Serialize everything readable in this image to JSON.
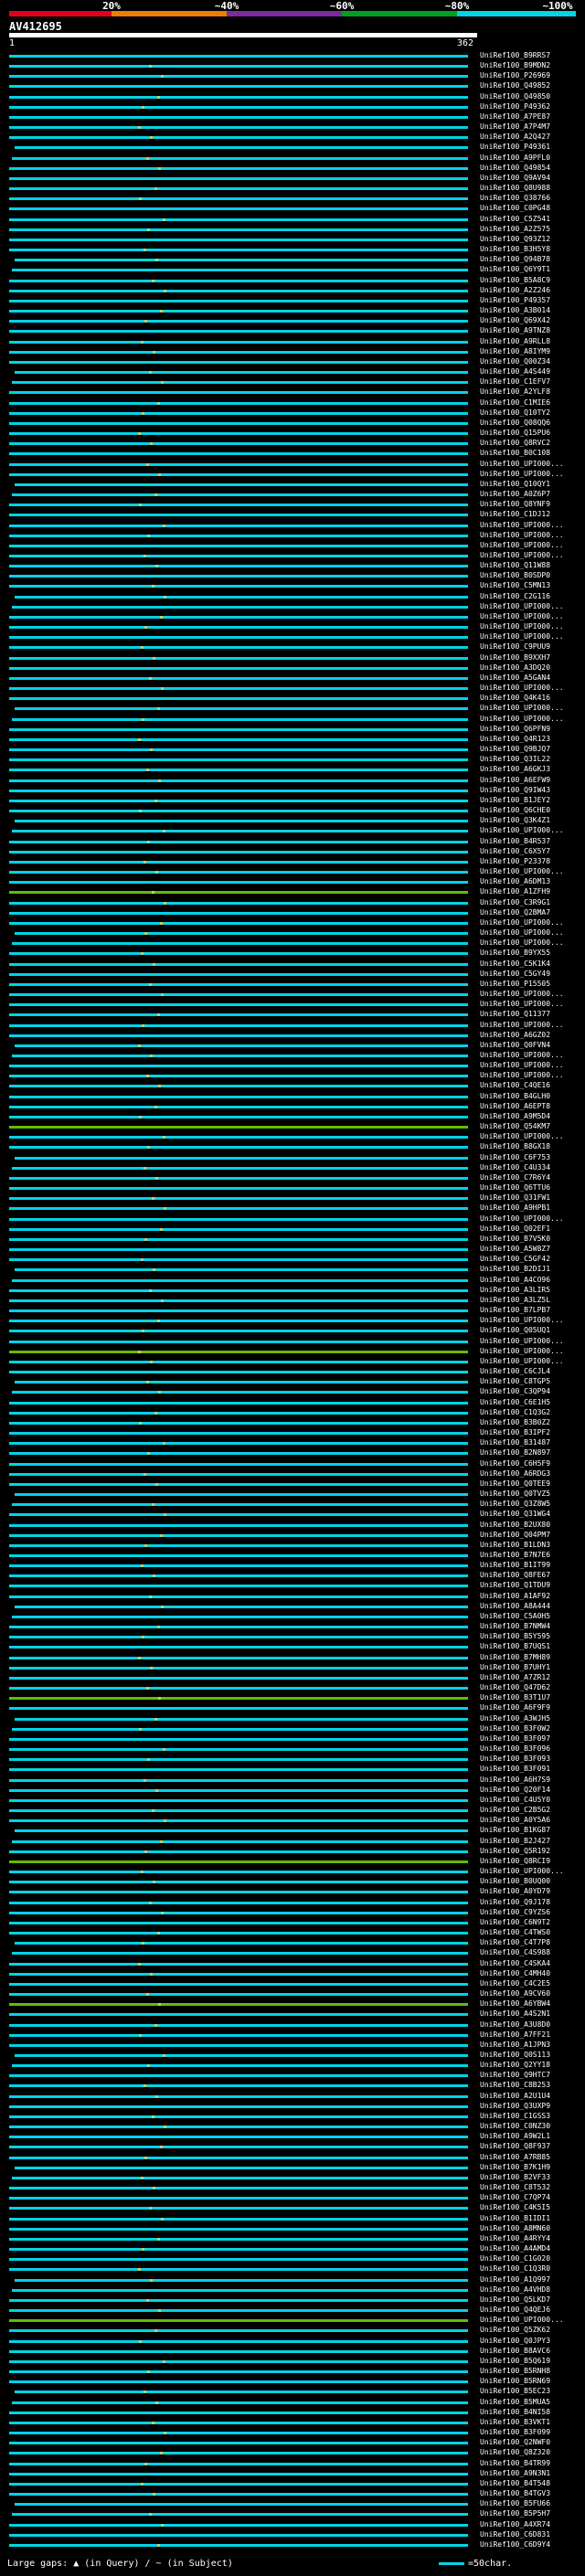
{
  "scale": {
    "ticks": [
      "20%",
      "~40%",
      "~60%",
      "~80%",
      "~100%"
    ],
    "band_colors": [
      "#e0001a",
      "#f07c00",
      "#7d2a9e",
      "#00a020",
      "#00d4e6"
    ]
  },
  "query": {
    "id": "AV412695",
    "start_label": "1",
    "end_label": "362"
  },
  "colors": {
    "high_identity": "#00d4e6",
    "mid_identity": "#66bb00",
    "dot": "#cccc66"
  },
  "hits": [
    {
      "label": "UniRef100_B9RRS7",
      "color": "#00d4e6"
    },
    {
      "label": "UniRef100_B9MDN2",
      "color": "#00d4e6"
    },
    {
      "label": "UniRef100_P26969",
      "color": "#00d4e6"
    },
    {
      "label": "UniRef100_Q49852",
      "color": "#00d4e6"
    },
    {
      "label": "UniRef100_Q49850",
      "color": "#00d4e6"
    },
    {
      "label": "UniRef100_P49362",
      "color": "#00d4e6"
    },
    {
      "label": "UniRef100_A7PE87",
      "color": "#00d4e6"
    },
    {
      "label": "UniRef100_A7P4M7",
      "color": "#00d4e6"
    },
    {
      "label": "UniRef100_A2Q427",
      "color": "#00d4e6"
    },
    {
      "label": "UniRef100_P49361",
      "color": "#00d4e6"
    },
    {
      "label": "UniRef100_A9PFL0",
      "color": "#00d4e6"
    },
    {
      "label": "UniRef100_Q49854",
      "color": "#00d4e6"
    },
    {
      "label": "UniRef100_Q9AV94",
      "color": "#00d4e6"
    },
    {
      "label": "UniRef100_Q8U988",
      "color": "#00d4e6"
    },
    {
      "label": "UniRef100_Q38766",
      "color": "#00d4e6"
    },
    {
      "label": "UniRef100_C0PG48",
      "color": "#00d4e6"
    },
    {
      "label": "UniRef100_C5Z541",
      "color": "#00d4e6"
    },
    {
      "label": "UniRef100_A2Z575",
      "color": "#00d4e6"
    },
    {
      "label": "UniRef100_Q93Z12",
      "color": "#00d4e6"
    },
    {
      "label": "UniRef100_B3H5Y8",
      "color": "#00d4e6"
    },
    {
      "label": "UniRef100_Q94B78",
      "color": "#00d4e6"
    },
    {
      "label": "UniRef100_Q6Y9T1",
      "color": "#00d4e6"
    },
    {
      "label": "UniRef100_B5A8C9",
      "color": "#00d4e6"
    },
    {
      "label": "UniRef100_A2Z246",
      "color": "#00d4e6"
    },
    {
      "label": "UniRef100_P49357",
      "color": "#00d4e6"
    },
    {
      "label": "UniRef100_A3B014",
      "color": "#00d4e6"
    },
    {
      "label": "UniRef100_Q69X42",
      "color": "#00d4e6"
    },
    {
      "label": "UniRef100_A9TNZ8",
      "color": "#00d4e6"
    },
    {
      "label": "UniRef100_A9RLL8",
      "color": "#00d4e6"
    },
    {
      "label": "UniRef100_A8IYM9",
      "color": "#00d4e6"
    },
    {
      "label": "UniRef100_Q00Z34",
      "color": "#00d4e6"
    },
    {
      "label": "UniRef100_A4S449",
      "color": "#00d4e6"
    },
    {
      "label": "UniRef100_C1EFV7",
      "color": "#00d4e6"
    },
    {
      "label": "UniRef100_A2YLF8",
      "color": "#00d4e6"
    },
    {
      "label": "UniRef100_C1MIE6",
      "color": "#00d4e6"
    },
    {
      "label": "UniRef100_Q10TY2",
      "color": "#00d4e6"
    },
    {
      "label": "UniRef100_Q08QQ6",
      "color": "#00d4e6"
    },
    {
      "label": "UniRef100_Q15PU6",
      "color": "#00d4e6"
    },
    {
      "label": "UniRef100_Q8RVC2",
      "color": "#00d4e6"
    },
    {
      "label": "UniRef100_B0C108",
      "color": "#00d4e6"
    },
    {
      "label": "UniRef100_UPI000...",
      "color": "#00d4e6"
    },
    {
      "label": "UniRef100_UPI000...",
      "color": "#00d4e6"
    },
    {
      "label": "UniRef100_Q10QY1",
      "color": "#00d4e6"
    },
    {
      "label": "UniRef100_A0Z6P7",
      "color": "#00d4e6"
    },
    {
      "label": "UniRef100_Q8YNF9",
      "color": "#00d4e6"
    },
    {
      "label": "UniRef100_C1DJ12",
      "color": "#00d4e6"
    },
    {
      "label": "UniRef100_UPI000...",
      "color": "#00d4e6"
    },
    {
      "label": "UniRef100_UPI000...",
      "color": "#00d4e6"
    },
    {
      "label": "UniRef100_UPI000...",
      "color": "#00d4e6"
    },
    {
      "label": "UniRef100_UPI000...",
      "color": "#00d4e6"
    },
    {
      "label": "UniRef100_Q11W88",
      "color": "#00d4e6"
    },
    {
      "label": "UniRef100_B0SDP0",
      "color": "#00d4e6"
    },
    {
      "label": "UniRef100_C5MN13",
      "color": "#00d4e6"
    },
    {
      "label": "UniRef100_C2G116",
      "color": "#00d4e6"
    },
    {
      "label": "UniRef100_UPI000...",
      "color": "#00d4e6"
    },
    {
      "label": "UniRef100_UPI000...",
      "color": "#00d4e6"
    },
    {
      "label": "UniRef100_UPI000...",
      "color": "#00d4e6"
    },
    {
      "label": "UniRef100_UPI000...",
      "color": "#00d4e6"
    },
    {
      "label": "UniRef100_C9PUU9",
      "color": "#00d4e6"
    },
    {
      "label": "UniRef100_B9XXH7",
      "color": "#00d4e6"
    },
    {
      "label": "UniRef100_A3DQ20",
      "color": "#00d4e6"
    },
    {
      "label": "UniRef100_A5GAN4",
      "color": "#00d4e6"
    },
    {
      "label": "UniRef100_UPI000...",
      "color": "#00d4e6"
    },
    {
      "label": "UniRef100_Q4K416",
      "color": "#00d4e6"
    },
    {
      "label": "UniRef100_UPI000...",
      "color": "#00d4e6"
    },
    {
      "label": "UniRef100_UPI000...",
      "color": "#00d4e6"
    },
    {
      "label": "UniRef100_Q6PFN9",
      "color": "#00d4e6"
    },
    {
      "label": "UniRef100_Q4R123",
      "color": "#00d4e6"
    },
    {
      "label": "UniRef100_Q9BJQ7",
      "color": "#00d4e6"
    },
    {
      "label": "UniRef100_Q3IL22",
      "color": "#00d4e6"
    },
    {
      "label": "UniRef100_A6GKJ3",
      "color": "#00d4e6"
    },
    {
      "label": "UniRef100_A6EFW9",
      "color": "#00d4e6"
    },
    {
      "label": "UniRef100_Q9IW43",
      "color": "#00d4e6"
    },
    {
      "label": "UniRef100_B1JEY2",
      "color": "#00d4e6"
    },
    {
      "label": "UniRef100_Q6CHE0",
      "color": "#00d4e6"
    },
    {
      "label": "UniRef100_Q3K4Z1",
      "color": "#00d4e6"
    },
    {
      "label": "UniRef100_UPI000...",
      "color": "#00d4e6"
    },
    {
      "label": "UniRef100_B4R537",
      "color": "#00d4e6"
    },
    {
      "label": "UniRef100_C6X5Y7",
      "color": "#00d4e6"
    },
    {
      "label": "UniRef100_P23378",
      "color": "#00d4e6"
    },
    {
      "label": "UniRef100_UPI000...",
      "color": "#00d4e6"
    },
    {
      "label": "UniRef100_A6DM13",
      "color": "#00d4e6"
    },
    {
      "label": "UniRef100_A1ZFH9",
      "color": "#66bb00"
    },
    {
      "label": "UniRef100_C3R9G1",
      "color": "#00d4e6"
    },
    {
      "label": "UniRef100_Q2BMA7",
      "color": "#00d4e6"
    },
    {
      "label": "UniRef100_UPI000...",
      "color": "#00d4e6"
    },
    {
      "label": "UniRef100_UPI000...",
      "color": "#00d4e6"
    },
    {
      "label": "UniRef100_UPI000...",
      "color": "#00d4e6"
    },
    {
      "label": "UniRef100_B9YX55",
      "color": "#00d4e6"
    },
    {
      "label": "UniRef100_C5K1K4",
      "color": "#00d4e6"
    },
    {
      "label": "UniRef100_C5GY49",
      "color": "#00d4e6"
    },
    {
      "label": "UniRef100_P15505",
      "color": "#00d4e6"
    },
    {
      "label": "UniRef100_UPI000...",
      "color": "#00d4e6"
    },
    {
      "label": "UniRef100_UPI000...",
      "color": "#00d4e6"
    },
    {
      "label": "UniRef100_Q11377",
      "color": "#00d4e6"
    },
    {
      "label": "UniRef100_UPI000...",
      "color": "#00d4e6"
    },
    {
      "label": "UniRef100_A6GZ02",
      "color": "#00d4e6"
    },
    {
      "label": "UniRef100_Q0FVN4",
      "color": "#00d4e6"
    },
    {
      "label": "UniRef100_UPI000...",
      "color": "#00d4e6"
    },
    {
      "label": "UniRef100_UPI000...",
      "color": "#00d4e6"
    },
    {
      "label": "UniRef100_UPI000...",
      "color": "#00d4e6"
    },
    {
      "label": "UniRef100_C4QE16",
      "color": "#00d4e6"
    },
    {
      "label": "UniRef100_B4GLH0",
      "color": "#00d4e6"
    },
    {
      "label": "UniRef100_A6EPT8",
      "color": "#00d4e6"
    },
    {
      "label": "UniRef100_A9M5D4",
      "color": "#00d4e6"
    },
    {
      "label": "UniRef100_Q54KM7",
      "color": "#66bb00"
    },
    {
      "label": "UniRef100_UPI000...",
      "color": "#00d4e6"
    },
    {
      "label": "UniRef100_B8GX18",
      "color": "#00d4e6"
    },
    {
      "label": "UniRef100_C6F753",
      "color": "#00d4e6"
    },
    {
      "label": "UniRef100_C4U334",
      "color": "#00d4e6"
    },
    {
      "label": "UniRef100_C7R6Y4",
      "color": "#00d4e6"
    },
    {
      "label": "UniRef100_Q6TTU6",
      "color": "#00d4e6"
    },
    {
      "label": "UniRef100_Q31FW1",
      "color": "#00d4e6"
    },
    {
      "label": "UniRef100_A9HPB1",
      "color": "#00d4e6"
    },
    {
      "label": "UniRef100_UPI000...",
      "color": "#00d4e6"
    },
    {
      "label": "UniRef100_Q02EF1",
      "color": "#00d4e6"
    },
    {
      "label": "UniRef100_B7V5K0",
      "color": "#00d4e6"
    },
    {
      "label": "UniRef100_A5W8Z7",
      "color": "#00d4e6"
    },
    {
      "label": "UniRef100_C5GF42",
      "color": "#00d4e6"
    },
    {
      "label": "UniRef100_B2DIJ1",
      "color": "#00d4e6"
    },
    {
      "label": "UniRef100_A4CO96",
      "color": "#00d4e6"
    },
    {
      "label": "UniRef100_A3LIR5",
      "color": "#00d4e6"
    },
    {
      "label": "UniRef100_A3LZ5L",
      "color": "#00d4e6"
    },
    {
      "label": "UniRef100_B7LPB7",
      "color": "#00d4e6"
    },
    {
      "label": "UniRef100_UPI000...",
      "color": "#00d4e6"
    },
    {
      "label": "UniRef100_Q05UQ1",
      "color": "#00d4e6"
    },
    {
      "label": "UniRef100_UPI000...",
      "color": "#00d4e6"
    },
    {
      "label": "UniRef100_UPI000...",
      "color": "#66bb00"
    },
    {
      "label": "UniRef100_UPI000...",
      "color": "#00d4e6"
    },
    {
      "label": "UniRef100_C6CJL4",
      "color": "#00d4e6"
    },
    {
      "label": "UniRef100_C8TGP5",
      "color": "#00d4e6"
    },
    {
      "label": "UniRef100_C3QP94",
      "color": "#00d4e6"
    },
    {
      "label": "UniRef100_C6E1H5",
      "color": "#00d4e6"
    },
    {
      "label": "UniRef100_C1Q3G2",
      "color": "#00d4e6"
    },
    {
      "label": "UniRef100_B3B0Z2",
      "color": "#00d4e6"
    },
    {
      "label": "UniRef100_B3IPF2",
      "color": "#00d4e6"
    },
    {
      "label": "UniRef100_B31487",
      "color": "#00d4e6"
    },
    {
      "label": "UniRef100_B2N897",
      "color": "#00d4e6"
    },
    {
      "label": "UniRef100_C6H5F9",
      "color": "#00d4e6"
    },
    {
      "label": "UniRef100_A6RDG3",
      "color": "#00d4e6"
    },
    {
      "label": "UniRef100_Q0TEE9",
      "color": "#00d4e6"
    },
    {
      "label": "UniRef100_Q0TVZ5",
      "color": "#00d4e6"
    },
    {
      "label": "UniRef100_Q3Z8W5",
      "color": "#00d4e6"
    },
    {
      "label": "UniRef100_Q31WG4",
      "color": "#00d4e6"
    },
    {
      "label": "UniRef100_B2UX80",
      "color": "#00d4e6"
    },
    {
      "label": "UniRef100_Q04PM7",
      "color": "#00d4e6"
    },
    {
      "label": "UniRef100_B1LDN3",
      "color": "#00d4e6"
    },
    {
      "label": "UniRef100_B7N7E6",
      "color": "#00d4e6"
    },
    {
      "label": "UniRef100_B1IT99",
      "color": "#00d4e6"
    },
    {
      "label": "UniRef100_Q8FE67",
      "color": "#00d4e6"
    },
    {
      "label": "UniRef100_Q1TDU9",
      "color": "#00d4e6"
    },
    {
      "label": "UniRef100_A1AF92",
      "color": "#00d4e6"
    },
    {
      "label": "UniRef100_A8A444",
      "color": "#00d4e6"
    },
    {
      "label": "UniRef100_C5A0H5",
      "color": "#00d4e6"
    },
    {
      "label": "UniRef100_B7NMW4",
      "color": "#00d4e6"
    },
    {
      "label": "UniRef100_B5Y595",
      "color": "#00d4e6"
    },
    {
      "label": "UniRef100_B7UQS1",
      "color": "#00d4e6"
    },
    {
      "label": "UniRef100_B7MH89",
      "color": "#00d4e6"
    },
    {
      "label": "UniRef100_B7UHY1",
      "color": "#00d4e6"
    },
    {
      "label": "UniRef100_A7ZR12",
      "color": "#00d4e6"
    },
    {
      "label": "UniRef100_Q47D62",
      "color": "#00d4e6"
    },
    {
      "label": "UniRef100_B3T1U7",
      "color": "#66bb00"
    },
    {
      "label": "UniRef100_A6F9F9",
      "color": "#00d4e6"
    },
    {
      "label": "UniRef100_A3WJH5",
      "color": "#00d4e6"
    },
    {
      "label": "UniRef100_B3F0W2",
      "color": "#00d4e6"
    },
    {
      "label": "UniRef100_B3F097",
      "color": "#00d4e6"
    },
    {
      "label": "UniRef100_B3F096",
      "color": "#00d4e6"
    },
    {
      "label": "UniRef100_B3F093",
      "color": "#00d4e6"
    },
    {
      "label": "UniRef100_B3F091",
      "color": "#00d4e6"
    },
    {
      "label": "UniRef100_A6H7S9",
      "color": "#00d4e6"
    },
    {
      "label": "UniRef100_Q20F14",
      "color": "#00d4e6"
    },
    {
      "label": "UniRef100_C4U5Y0",
      "color": "#00d4e6"
    },
    {
      "label": "UniRef100_C2B5G2",
      "color": "#00d4e6"
    },
    {
      "label": "UniRef100_A0Y5A6",
      "color": "#00d4e6"
    },
    {
      "label": "UniRef100_B1KG87",
      "color": "#00d4e6"
    },
    {
      "label": "UniRef100_B2J427",
      "color": "#00d4e6"
    },
    {
      "label": "UniRef100_Q5R192",
      "color": "#00d4e6"
    },
    {
      "label": "UniRef100_Q8RCI9",
      "color": "#66bb00"
    },
    {
      "label": "UniRef100_UPI000...",
      "color": "#00d4e6"
    },
    {
      "label": "UniRef100_B0UQ00",
      "color": "#00d4e6"
    },
    {
      "label": "UniRef100_A0YD79",
      "color": "#00d4e6"
    },
    {
      "label": "UniRef100_Q9J178",
      "color": "#00d4e6"
    },
    {
      "label": "UniRef100_C9YZS6",
      "color": "#00d4e6"
    },
    {
      "label": "UniRef100_C6N9T2",
      "color": "#00d4e6"
    },
    {
      "label": "UniRef100_C4TWS0",
      "color": "#00d4e6"
    },
    {
      "label": "UniRef100_C4T7P8",
      "color": "#00d4e6"
    },
    {
      "label": "UniRef100_C4S988",
      "color": "#00d4e6"
    },
    {
      "label": "UniRef100_C4SKA4",
      "color": "#00d4e6"
    },
    {
      "label": "UniRef100_C4MH40",
      "color": "#00d4e6"
    },
    {
      "label": "UniRef100_C4C2E5",
      "color": "#00d4e6"
    },
    {
      "label": "UniRef100_A9CV60",
      "color": "#00d4e6"
    },
    {
      "label": "UniRef100_A6YBW4",
      "color": "#66bb00"
    },
    {
      "label": "UniRef100_A4S2N1",
      "color": "#00d4e6"
    },
    {
      "label": "UniRef100_A3U8D0",
      "color": "#00d4e6"
    },
    {
      "label": "UniRef100_A7FF21",
      "color": "#00d4e6"
    },
    {
      "label": "UniRef100_A1JPN3",
      "color": "#00d4e6"
    },
    {
      "label": "UniRef100_Q0S113",
      "color": "#00d4e6"
    },
    {
      "label": "UniRef100_Q2YY18",
      "color": "#00d4e6"
    },
    {
      "label": "UniRef100_Q9HTC7",
      "color": "#00d4e6"
    },
    {
      "label": "UniRef100_C8B253",
      "color": "#00d4e6"
    },
    {
      "label": "UniRef100_A2U1U4",
      "color": "#00d4e6"
    },
    {
      "label": "UniRef100_Q3UXP9",
      "color": "#00d4e6"
    },
    {
      "label": "UniRef100_C1GSS3",
      "color": "#00d4e6"
    },
    {
      "label": "UniRef100_C0NZ30",
      "color": "#00d4e6"
    },
    {
      "label": "UniRef100_A9W2L1",
      "color": "#00d4e6"
    },
    {
      "label": "UniRef100_Q8F937",
      "color": "#00d4e6"
    },
    {
      "label": "UniRef100_A7RB85",
      "color": "#00d4e6"
    },
    {
      "label": "UniRef100_B7K1H9",
      "color": "#00d4e6"
    },
    {
      "label": "UniRef100_B2VF33",
      "color": "#00d4e6"
    },
    {
      "label": "UniRef100_C8T532",
      "color": "#00d4e6"
    },
    {
      "label": "UniRef100_C7QP74",
      "color": "#00d4e6"
    },
    {
      "label": "UniRef100_C4K5I5",
      "color": "#00d4e6"
    },
    {
      "label": "UniRef100_B1IDI1",
      "color": "#00d4e6"
    },
    {
      "label": "UniRef100_A8MN60",
      "color": "#00d4e6"
    },
    {
      "label": "UniRef100_A4RYY4",
      "color": "#00d4e6"
    },
    {
      "label": "UniRef100_A4AMD4",
      "color": "#00d4e6"
    },
    {
      "label": "UniRef100_C1G020",
      "color": "#00d4e6"
    },
    {
      "label": "UniRef100_C1Q3R0",
      "color": "#00d4e6"
    },
    {
      "label": "UniRef100_A1Q997",
      "color": "#00d4e6"
    },
    {
      "label": "UniRef100_A4VHD8",
      "color": "#00d4e6"
    },
    {
      "label": "UniRef100_Q5LKD7",
      "color": "#00d4e6"
    },
    {
      "label": "UniRef100_Q4QEJ6",
      "color": "#00d4e6"
    },
    {
      "label": "UniRef100_UPI000...",
      "color": "#66bb00"
    },
    {
      "label": "UniRef100_Q5ZK62",
      "color": "#00d4e6"
    },
    {
      "label": "UniRef100_Q0JPY3",
      "color": "#00d4e6"
    },
    {
      "label": "UniRef100_B8AVC6",
      "color": "#00d4e6"
    },
    {
      "label": "UniRef100_B5Q619",
      "color": "#00d4e6"
    },
    {
      "label": "UniRef100_B5RNH8",
      "color": "#00d4e6"
    },
    {
      "label": "UniRef100_B5RN69",
      "color": "#00d4e6"
    },
    {
      "label": "UniRef100_B5EC23",
      "color": "#00d4e6"
    },
    {
      "label": "UniRef100_B5MUA5",
      "color": "#00d4e6"
    },
    {
      "label": "UniRef100_B4NI58",
      "color": "#00d4e6"
    },
    {
      "label": "UniRef100_B3VKT1",
      "color": "#00d4e6"
    },
    {
      "label": "UniRef100_B3F099",
      "color": "#00d4e6"
    },
    {
      "label": "UniRef100_Q2NWF0",
      "color": "#00d4e6"
    },
    {
      "label": "UniRef100_Q8Z320",
      "color": "#00d4e6"
    },
    {
      "label": "UniRef100_B4TR99",
      "color": "#00d4e6"
    },
    {
      "label": "UniRef100_A9N3N1",
      "color": "#00d4e6"
    },
    {
      "label": "UniRef100_B4T548",
      "color": "#00d4e6"
    },
    {
      "label": "UniRef100_B4TGV3",
      "color": "#00d4e6"
    },
    {
      "label": "UniRef100_B5FU66",
      "color": "#00d4e6"
    },
    {
      "label": "UniRef100_B5P5H7",
      "color": "#00d4e6"
    },
    {
      "label": "UniRef100_A4XR74",
      "color": "#00d4e6"
    },
    {
      "label": "UniRef100_C6D831",
      "color": "#00d4e6"
    },
    {
      "label": "UniRef100_C6D9Y4",
      "color": "#00d4e6"
    }
  ],
  "footer": {
    "large_gaps_label": "Large gaps: ▲ (in Query) / ~ (in Subject)",
    "legend_label": "=50char."
  }
}
